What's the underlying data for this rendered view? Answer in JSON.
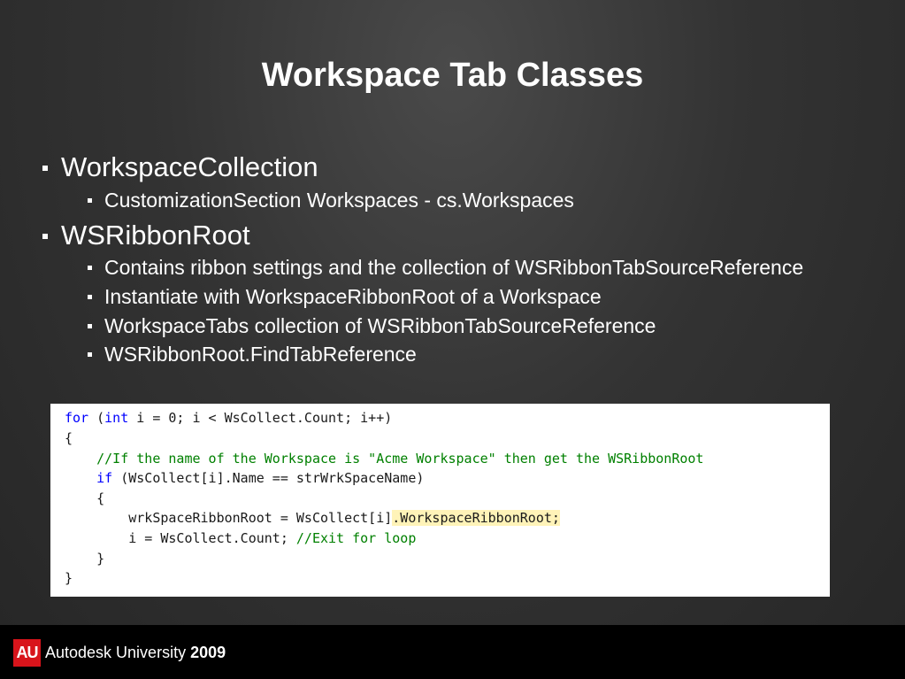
{
  "slide": {
    "title": "Workspace Tab Classes",
    "bullets": [
      {
        "text": "WorkspaceCollection",
        "level": 1
      },
      {
        "text": "CustomizationSection Workspaces - cs.Workspaces",
        "level": 2
      },
      {
        "text": "WSRibbonRoot",
        "level": 1
      },
      {
        "text": "Contains ribbon settings and the collection of WSRibbonTabSourceReference",
        "level": 2
      },
      {
        "text": "Instantiate with WorkspaceRibbonRoot of a Workspace",
        "level": 2
      },
      {
        "text": "WorkspaceTabs collection of WSRibbonTabSourceReference",
        "level": 2
      },
      {
        "text": "WSRibbonRoot.FindTabReference",
        "level": 2
      }
    ]
  },
  "code": {
    "line1": {
      "kw": "for",
      "kw2": "int",
      "a": " (",
      "b": " i = 0; i < WsCollect.Count; i++)"
    },
    "line2": "{",
    "line3": {
      "indent": "    ",
      "comment": "//If the name of the Workspace is \"Acme Workspace\" then get the WSRibbonRoot"
    },
    "line4": {
      "indent": "    ",
      "kw": "if",
      "rest": " (WsCollect[i].Name == strWrkSpaceName)"
    },
    "line5": "    {",
    "line6": {
      "indent": "        ",
      "text": "wrkSpaceRibbonRoot = WsCollect[i]",
      "highlight": ".WorkspaceRibbonRoot;"
    },
    "line7": {
      "indent": "        ",
      "text": "i = WsCollect.Count; ",
      "comment": "//Exit for loop"
    },
    "line8": "    }",
    "line9": "}"
  },
  "footer": {
    "logo_text": "AU",
    "brand": "Autodesk University",
    "year": "2009"
  },
  "colors": {
    "code_keyword": "#0000ff",
    "code_comment": "#008000",
    "code_highlight": "#fff3b8",
    "logo_red": "#d8141b"
  }
}
